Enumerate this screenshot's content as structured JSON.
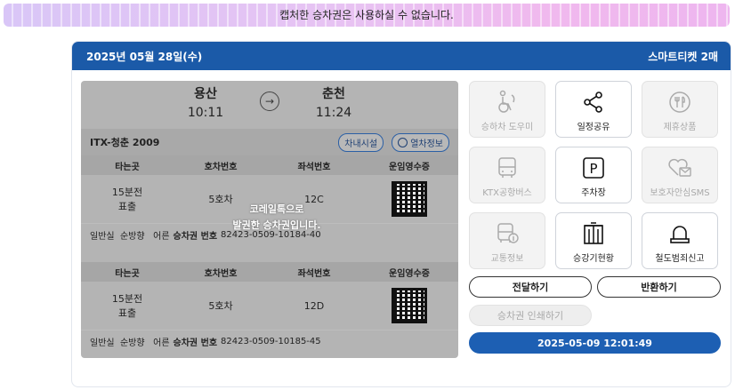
{
  "banner": {
    "text": "캡처한 승차권은 사용하실 수 없습니다."
  },
  "header": {
    "date": "2025년 05월 28일(수)",
    "ticket_count": "스마트티켓 2매"
  },
  "ticket": {
    "departure": {
      "station": "용산",
      "time": "10:11"
    },
    "arrival": {
      "station": "춘천",
      "time": "11:24"
    },
    "train_name": "ITX-청춘 2009",
    "facility_button": "차내시설",
    "train_info_button": "열차정보",
    "columns": [
      "타는곳",
      "호차번호",
      "좌석번호",
      "운임영수증"
    ],
    "seats": [
      {
        "platform": "15분전 표출",
        "car": "5호차",
        "seat": "12C",
        "info": {
          "class": "일반실",
          "direction": "순방향",
          "type": "어른",
          "no_label": "승차권 번호",
          "no": "82423-0509-10184-40"
        }
      },
      {
        "platform": "15분전 표출",
        "car": "5호차",
        "seat": "12D",
        "info": {
          "class": "일반실",
          "direction": "순방향",
          "type": "어른",
          "no_label": "승차권 번호",
          "no": "82423-0509-10185-45"
        }
      }
    ],
    "overlay_line1": "코레일톡으로",
    "overlay_line2": "발권한 승차권입니다."
  },
  "services": [
    {
      "label": "승하차 도우미",
      "icon": "accessibility-icon",
      "enabled": false
    },
    {
      "label": "일정공유",
      "icon": "share-icon",
      "enabled": true
    },
    {
      "label": "제휴상품",
      "icon": "dining-icon",
      "enabled": false
    },
    {
      "label": "KTX공항버스",
      "icon": "bus-icon",
      "enabled": false
    },
    {
      "label": "주차장",
      "icon": "parking-icon",
      "enabled": true
    },
    {
      "label": "보호자안심SMS",
      "icon": "heart-message-icon",
      "enabled": false
    },
    {
      "label": "교통정보",
      "icon": "transit-info-icon",
      "enabled": false
    },
    {
      "label": "승강기현황",
      "icon": "elevator-icon",
      "enabled": true
    },
    {
      "label": "철도범죄신고",
      "icon": "siren-icon",
      "enabled": true
    }
  ],
  "actions": {
    "transfer": "전달하기",
    "refund": "반환하기",
    "print": "승차권 인쇄하기",
    "timestamp": "2025-05-09 12:01:49"
  },
  "colors": {
    "header_blue": "#1b5aa8",
    "primary_button": "#1d5fb3",
    "ticket_gray": "#b4b4b4"
  }
}
